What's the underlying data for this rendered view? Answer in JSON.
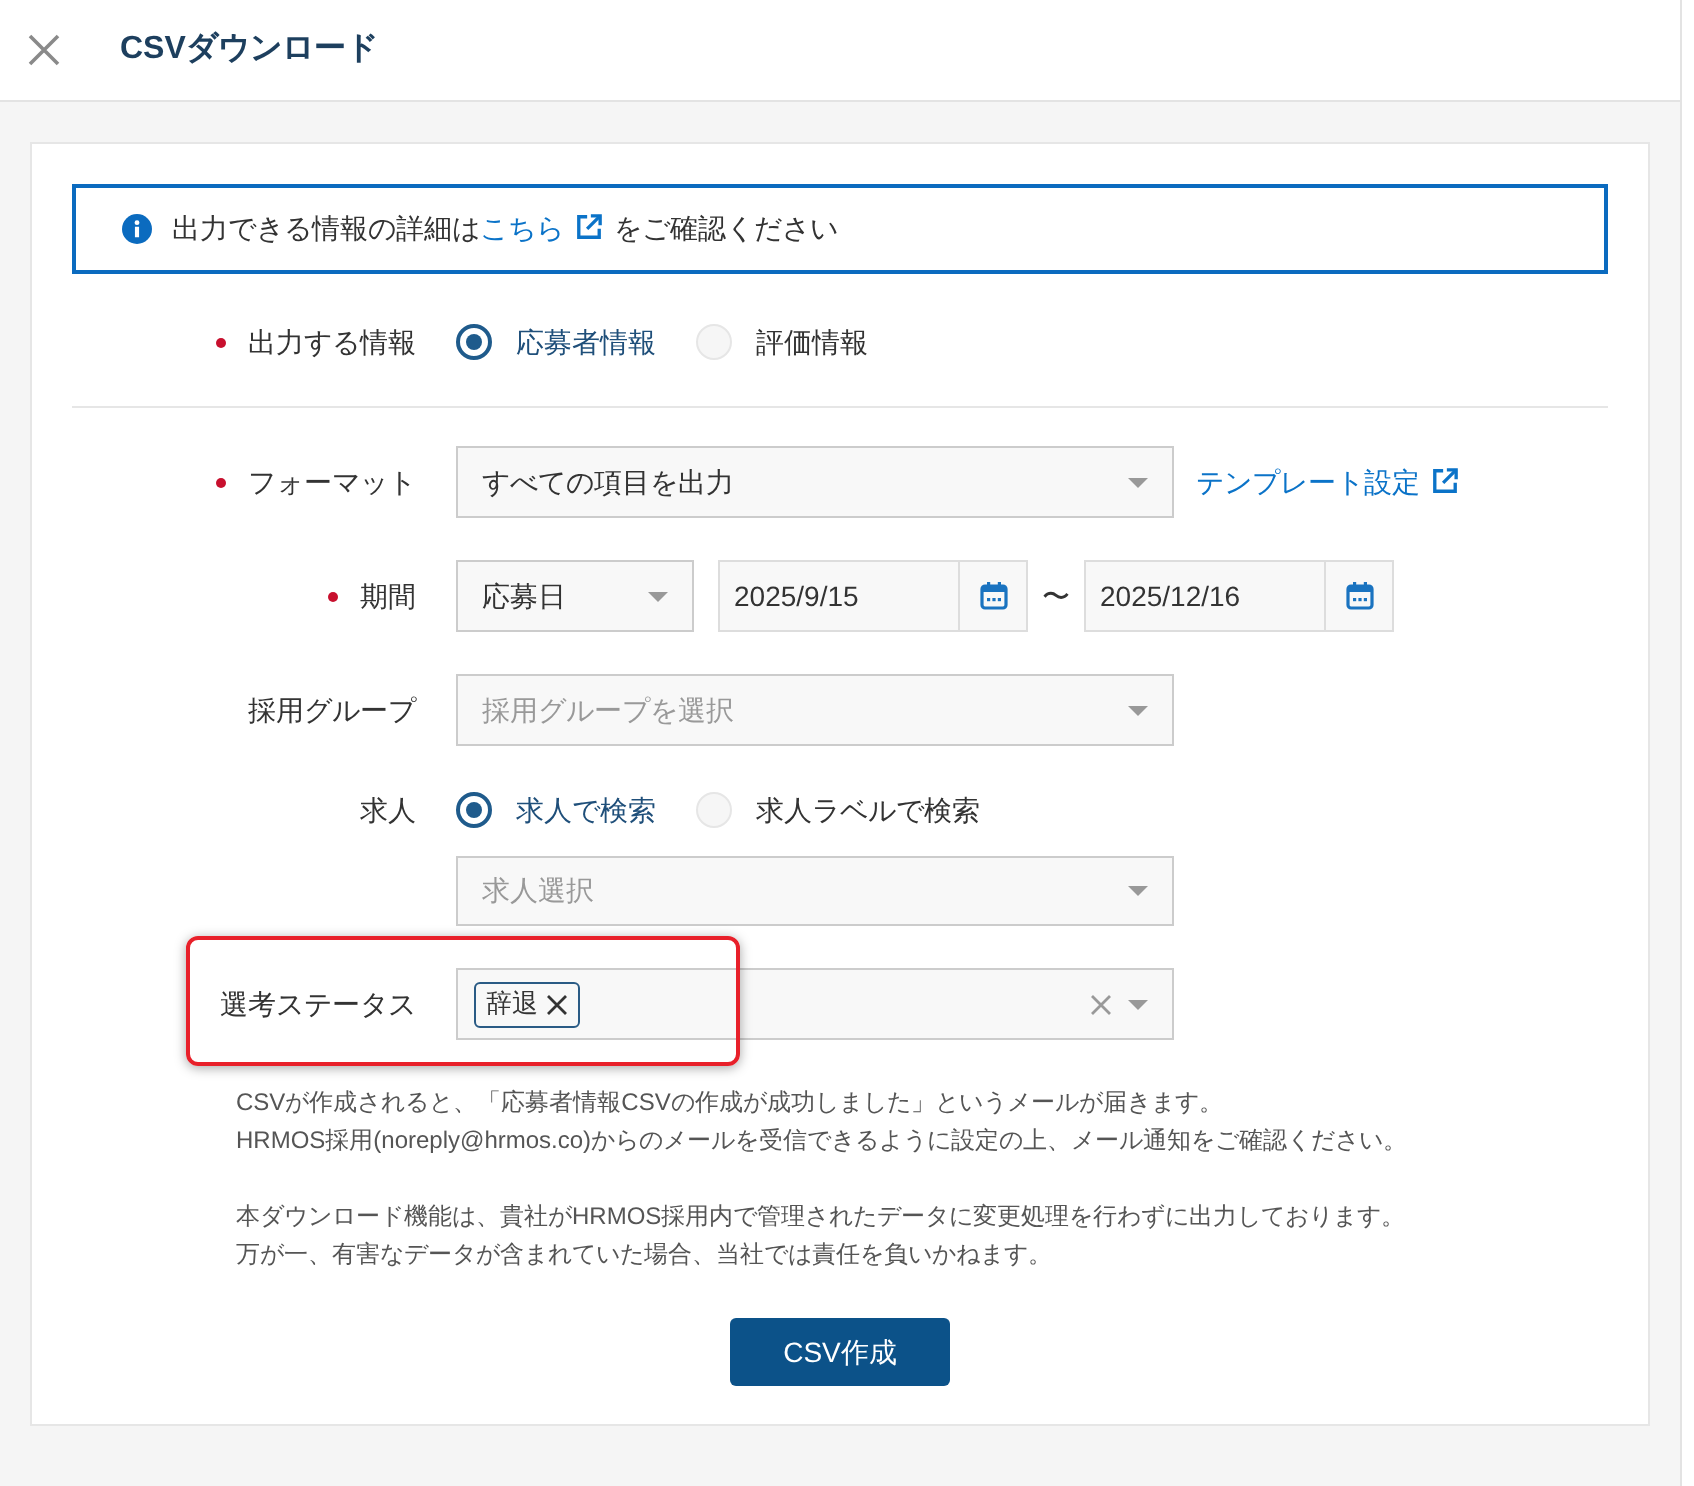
{
  "dialog": {
    "title": "CSVダウンロード"
  },
  "info": {
    "text_before": "出力できる情報の詳細は",
    "link": "こちら",
    "text_after": "をご確認ください"
  },
  "output_info": {
    "label": "出力する情報",
    "required": true,
    "options": [
      {
        "label": "応募者情報",
        "selected": true
      },
      {
        "label": "評価情報",
        "selected": false
      }
    ]
  },
  "format": {
    "label": "フォーマット",
    "required": true,
    "value": "すべての項目を出力",
    "link": "テンプレート設定"
  },
  "period": {
    "label": "期間",
    "required": true,
    "basis": "応募日",
    "start": "2025/9/15",
    "separator": "〜",
    "end": "2025/12/16"
  },
  "recruit_group": {
    "label": "採用グループ",
    "required": false,
    "placeholder": "採用グループを選択"
  },
  "job": {
    "label": "求人",
    "required": false,
    "options": [
      {
        "label": "求人で検索",
        "selected": true
      },
      {
        "label": "求人ラベルで検索",
        "selected": false
      }
    ],
    "placeholder": "求人選択"
  },
  "status": {
    "label": "選考ステータス",
    "required": false,
    "highlighted": true,
    "tags": [
      "辞退"
    ]
  },
  "notes": [
    [
      "CSVが作成されると、「応募者情報CSVの作成が成功しました」というメールが届きます。",
      "HRMOS採用(noreply@hrmos.co)からのメールを受信できるように設定の上、メール通知をご確認ください。"
    ],
    [
      "本ダウンロード機能は、貴社がHRMOS採用内で管理されたデータに変更処理を行わずに出力しております。",
      "万が一、有害なデータが含まれていた場合、当社では責任を負いかねます。"
    ]
  ],
  "submit_button": "CSV作成"
}
